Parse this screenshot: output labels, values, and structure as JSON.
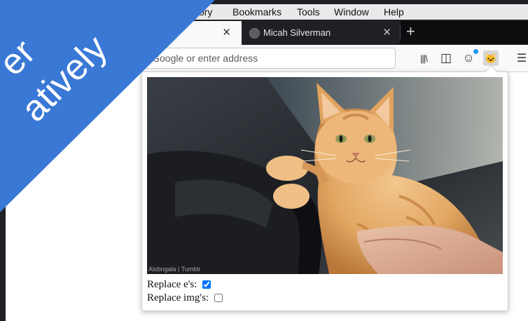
{
  "menubar": {
    "items": [
      "tory",
      "Bookmarks",
      "Tools",
      "Window",
      "Help"
    ]
  },
  "tabs": {
    "active": {
      "close_glyph": "×"
    },
    "inactive": {
      "label": "Micah Silverman",
      "close_glyph": "×"
    },
    "new_tab_glyph": "+"
  },
  "toolbar": {
    "address_placeholder": "rch with Google or enter address",
    "library_glyph": "|||\\",
    "sidebar_glyph": "◫",
    "account_glyph": "☺",
    "extension_glyph": "🐱",
    "menu_glyph": "☰"
  },
  "popup": {
    "photo_credit": "Alxbngala | Tumblr",
    "options": [
      {
        "label": "Replace e's:",
        "checked": true
      },
      {
        "label": "Replace img's:",
        "checked": false
      }
    ]
  },
  "banner": {
    "line1": "er",
    "line2": "atively",
    "color": "#3a78d6"
  }
}
